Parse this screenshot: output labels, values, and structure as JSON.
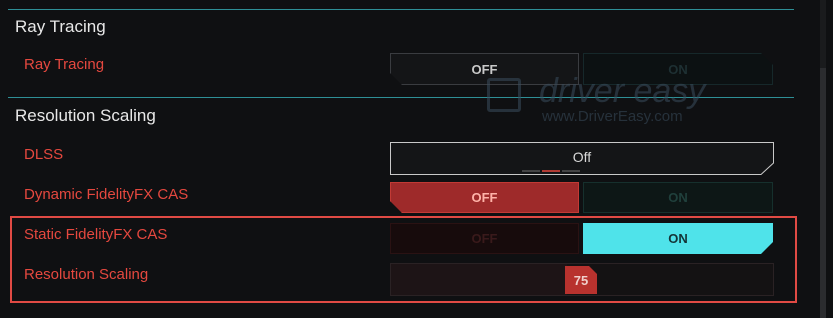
{
  "sections": {
    "ray_tracing": {
      "title": "Ray Tracing",
      "rows": [
        {
          "label": "Ray Tracing",
          "off": "OFF",
          "on": "ON",
          "selected": "OFF"
        }
      ]
    },
    "resolution_scaling": {
      "title": "Resolution Scaling",
      "dlss": {
        "label": "DLSS",
        "value": "Off"
      },
      "dynamic_cas": {
        "label": "Dynamic FidelityFX CAS",
        "off": "OFF",
        "on": "ON",
        "selected": "OFF"
      },
      "static_cas": {
        "label": "Static FidelityFX CAS",
        "off": "OFF",
        "on": "ON",
        "selected": "ON"
      },
      "resolution_scaling": {
        "label": "Resolution Scaling",
        "value": "75",
        "fraction": 0.5
      }
    }
  },
  "watermark": {
    "brand": "driver easy",
    "url": "www.DriverEasy.com"
  },
  "colors": {
    "accent_red": "#e5483f",
    "accent_cyan": "#4fe3ea",
    "section_line": "#2e8f96",
    "highlight_box": "#e04a44"
  }
}
